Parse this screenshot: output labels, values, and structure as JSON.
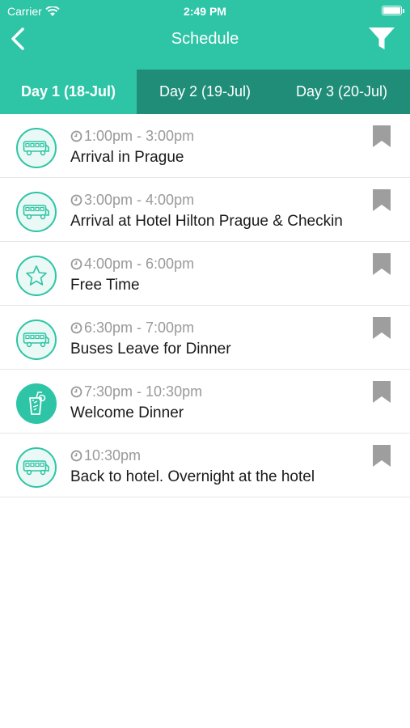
{
  "status_bar": {
    "carrier": "Carrier",
    "time": "2:49 PM"
  },
  "header": {
    "title": "Schedule"
  },
  "tabs": [
    {
      "label": "Day 1 (18-Jul)",
      "active": true
    },
    {
      "label": "Day 2 (19-Jul)",
      "active": false
    },
    {
      "label": "Day 3 (20-Jul)",
      "active": false
    }
  ],
  "events": [
    {
      "time": "1:00pm - 3:00pm",
      "title": "Arrival in Prague",
      "icon": "bus-icon"
    },
    {
      "time": "3:00pm - 4:00pm",
      "title": "Arrival at Hotel Hilton Prague & Checkin",
      "icon": "bus-icon"
    },
    {
      "time": "4:00pm - 6:00pm",
      "title": "Free Time",
      "icon": "star-icon"
    },
    {
      "time": "6:30pm - 7:00pm",
      "title": "Buses Leave for Dinner",
      "icon": "bus-icon"
    },
    {
      "time": "7:30pm - 10:30pm",
      "title": "Welcome Dinner",
      "icon": "drink-icon"
    },
    {
      "time": "10:30pm",
      "title": "Back to hotel. Overnight at the hotel",
      "icon": "bus-icon"
    }
  ],
  "colors": {
    "accent": "#2ec4a6",
    "tab_inactive": "#1f8d78",
    "muted_text": "#9a9a9a",
    "bookmark": "#9e9e9e"
  }
}
